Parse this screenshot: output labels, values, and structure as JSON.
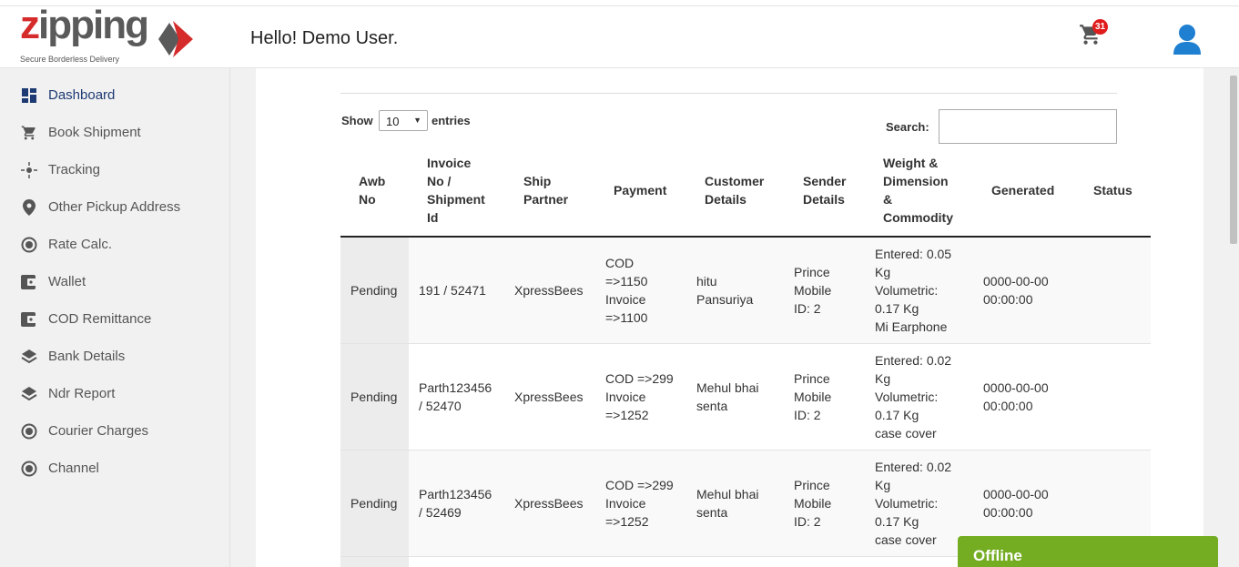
{
  "logo": {
    "word_a": "z",
    "word_b": "ipping",
    "tagline": "Secure Borderless Delivery"
  },
  "header": {
    "greeting": "Hello! Demo User.",
    "cart_count": "31"
  },
  "sidebar": {
    "items": [
      {
        "label": "Dashboard",
        "icon": "dashboard-icon"
      },
      {
        "label": "Book Shipment",
        "icon": "cart-icon"
      },
      {
        "label": "Tracking",
        "icon": "tracking-icon"
      },
      {
        "label": "Other Pickup Address",
        "icon": "location-pin-icon"
      },
      {
        "label": "Rate Calc.",
        "icon": "radio-dot-icon"
      },
      {
        "label": "Wallet",
        "icon": "wallet-icon"
      },
      {
        "label": "COD Remittance",
        "icon": "wallet-icon"
      },
      {
        "label": "Bank Details",
        "icon": "layers-icon"
      },
      {
        "label": "Ndr Report",
        "icon": "layers-icon"
      },
      {
        "label": "Courier Charges",
        "icon": "radio-dot-icon"
      },
      {
        "label": "Channel",
        "icon": "radio-dot-icon"
      }
    ]
  },
  "controls": {
    "show_label": "Show",
    "entries_value": "10",
    "entries_label": "entries",
    "search_label": "Search:",
    "search_value": ""
  },
  "table": {
    "headers": {
      "awb": [
        "Awb",
        "No"
      ],
      "invoice": [
        "Invoice",
        "No /",
        "Shipment",
        "Id"
      ],
      "ship": [
        "Ship",
        "Partner"
      ],
      "payment": [
        "Payment"
      ],
      "customer": [
        "Customer",
        "Details"
      ],
      "sender": [
        "Sender",
        "Details"
      ],
      "weight": [
        "Weight &",
        "Dimension",
        "&",
        "Commodity"
      ],
      "generated": [
        "Generated"
      ],
      "status": [
        "Status"
      ]
    },
    "rows": [
      {
        "awb": [
          "Pending"
        ],
        "invoice": [
          "191 / 52471"
        ],
        "ship": [
          "XpressBees"
        ],
        "payment": [
          "COD",
          "=>1150",
          "Invoice",
          "=>1100"
        ],
        "customer": [
          "hitu",
          "Pansuriya"
        ],
        "sender": [
          "Prince",
          "Mobile",
          "ID: 2"
        ],
        "weight": [
          "Entered: 0.05",
          "Kg",
          "Volumetric:",
          "0.17 Kg",
          "Mi Earphone"
        ],
        "generated": [
          "0000-00-00",
          "00:00:00"
        ],
        "status": [
          ""
        ]
      },
      {
        "awb": [
          "Pending"
        ],
        "invoice": [
          "Parth123456",
          "/ 52470"
        ],
        "ship": [
          "XpressBees"
        ],
        "payment": [
          "COD =>299",
          "Invoice",
          "=>1252"
        ],
        "customer": [
          "Mehul bhai",
          "senta"
        ],
        "sender": [
          "Prince",
          "Mobile",
          "ID: 2"
        ],
        "weight": [
          "Entered: 0.02",
          "Kg",
          "Volumetric:",
          "0.17 Kg",
          "case cover"
        ],
        "generated": [
          "0000-00-00",
          "00:00:00"
        ],
        "status": [
          ""
        ]
      },
      {
        "awb": [
          "Pending"
        ],
        "invoice": [
          "Parth123456",
          "/ 52469"
        ],
        "ship": [
          "XpressBees"
        ],
        "payment": [
          "COD =>299",
          "Invoice",
          "=>1252"
        ],
        "customer": [
          "Mehul bhai",
          "senta"
        ],
        "sender": [
          "Prince",
          "Mobile",
          "ID: 2"
        ],
        "weight": [
          "Entered: 0.02",
          "Kg",
          "Volumetric:",
          "0.17 Kg",
          "case cover"
        ],
        "generated": [
          "0000-00-00",
          "00:00:00"
        ],
        "status": [
          ""
        ]
      }
    ]
  },
  "chat": {
    "label": "Offline"
  },
  "colors": {
    "brand_red": "#d52b2b",
    "nav_active": "#1d3a73",
    "chat_green": "#74ad22",
    "badge_red": "#e01c1c",
    "user_blue": "#1f7fd0"
  }
}
